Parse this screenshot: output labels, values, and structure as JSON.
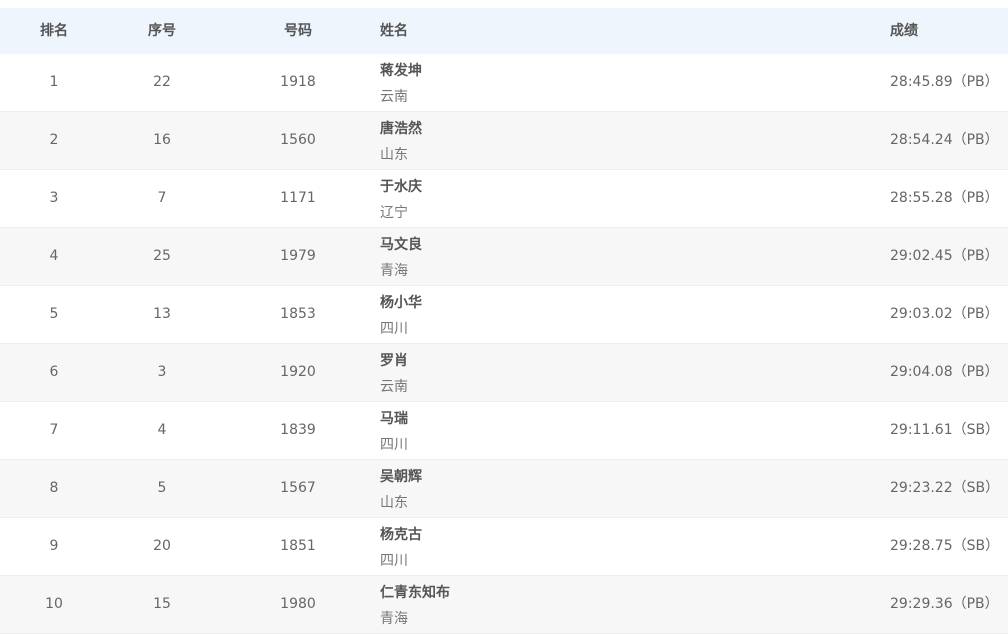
{
  "header": {
    "rank": "排名",
    "seq": "序号",
    "number": "号码",
    "name": "姓名",
    "score": "成绩"
  },
  "rows": [
    {
      "rank": "1",
      "seq": "22",
      "number": "1918",
      "name": "蒋发坤",
      "province": "云南",
      "score": "28:45.89（PB）"
    },
    {
      "rank": "2",
      "seq": "16",
      "number": "1560",
      "name": "唐浩然",
      "province": "山东",
      "score": "28:54.24（PB）"
    },
    {
      "rank": "3",
      "seq": "7",
      "number": "1171",
      "name": "于水庆",
      "province": "辽宁",
      "score": "28:55.28（PB）"
    },
    {
      "rank": "4",
      "seq": "25",
      "number": "1979",
      "name": "马文良",
      "province": "青海",
      "score": "29:02.45（PB）"
    },
    {
      "rank": "5",
      "seq": "13",
      "number": "1853",
      "name": "杨小华",
      "province": "四川",
      "score": "29:03.02（PB）"
    },
    {
      "rank": "6",
      "seq": "3",
      "number": "1920",
      "name": "罗肖",
      "province": "云南",
      "score": "29:04.08（PB）"
    },
    {
      "rank": "7",
      "seq": "4",
      "number": "1839",
      "name": "马瑞",
      "province": "四川",
      "score": "29:11.61（SB）"
    },
    {
      "rank": "8",
      "seq": "5",
      "number": "1567",
      "name": "吴朝辉",
      "province": "山东",
      "score": "29:23.22（SB）"
    },
    {
      "rank": "9",
      "seq": "20",
      "number": "1851",
      "name": "杨克古",
      "province": "四川",
      "score": "29:28.75（SB）"
    },
    {
      "rank": "10",
      "seq": "15",
      "number": "1980",
      "name": "仁青东知布",
      "province": "青海",
      "score": "29:29.36（PB）"
    }
  ]
}
